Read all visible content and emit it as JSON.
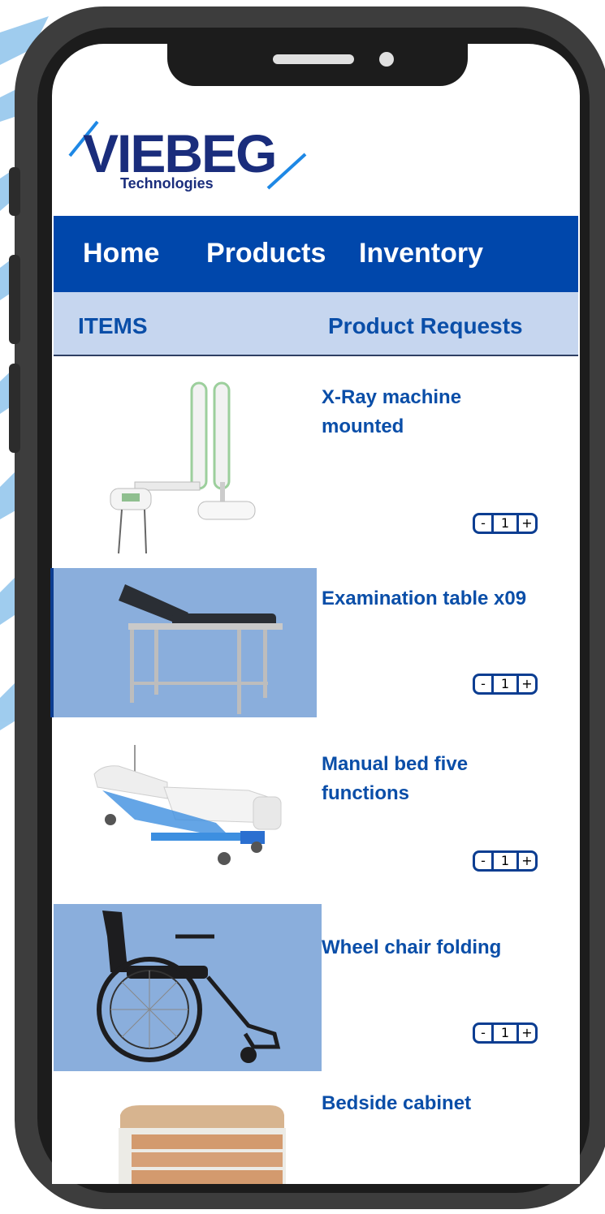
{
  "brand": {
    "name": "VIEBEG",
    "tagline": "Technologies",
    "color": "#1a2d7c",
    "accent": "#1e88e5"
  },
  "nav": {
    "items": [
      "Home",
      "Products",
      "Inventory"
    ],
    "bg_color": "#0047ab"
  },
  "subnav": {
    "items_label": "ITEMS",
    "requests_label": "Product Requests",
    "bg_color": "#c6d6ef"
  },
  "products": [
    {
      "name": "X-Ray machine mounted",
      "quantity": "1",
      "minus": "-",
      "plus": "+",
      "image_icon": "xray-machine-image"
    },
    {
      "name": "Examination table x09",
      "quantity": "1",
      "minus": "-",
      "plus": "+",
      "image_icon": "examination-table-image"
    },
    {
      "name": "Manual bed five functions",
      "quantity": "1",
      "minus": "-",
      "plus": "+",
      "image_icon": "hospital-bed-image"
    },
    {
      "name": "Wheel chair folding",
      "quantity": "1",
      "minus": "-",
      "plus": "+",
      "image_icon": "wheelchair-image"
    },
    {
      "name": "Bedside cabinet",
      "image_icon": "bedside-cabinet-image"
    }
  ]
}
